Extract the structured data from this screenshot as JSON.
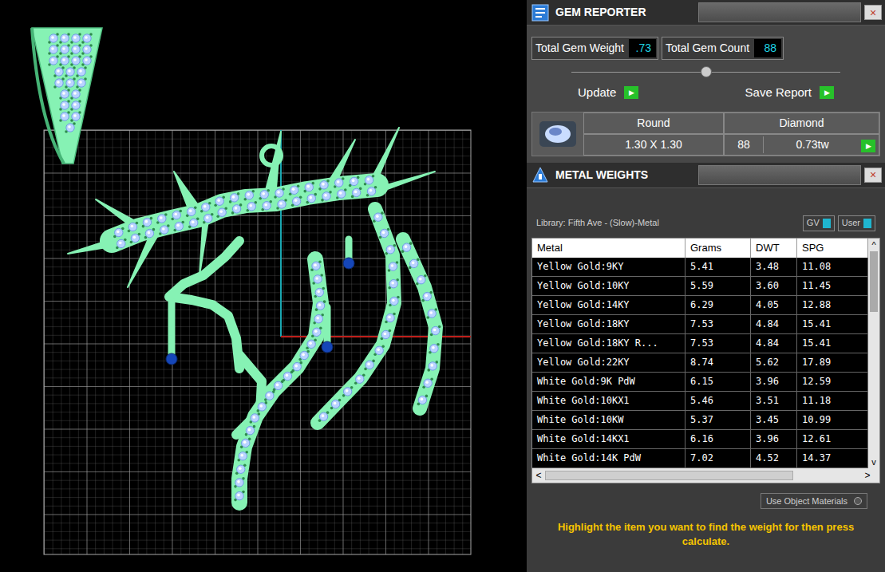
{
  "gem_reporter": {
    "title": "GEM REPORTER",
    "close": "×",
    "total_gem_weight": {
      "label": "Total Gem Weight",
      "value": ".73"
    },
    "total_gem_count": {
      "label": "Total Gem Count",
      "value": "88"
    },
    "slider": {
      "level": 0.5
    },
    "buttons": [
      {
        "label": "Update",
        "arrow": "▶"
      },
      {
        "label": "Save Report",
        "arrow": "▶"
      }
    ],
    "gems": [
      {
        "shape": "Round",
        "material": "Diamond",
        "size": "1.30 X 1.30",
        "count": "88",
        "weight": "0.73tw",
        "arrow": "▶"
      }
    ]
  },
  "metal_weights": {
    "title": "METAL WEIGHTS",
    "close": "×",
    "library": "Library: Fifth Ave - (Slow)-Metal",
    "toggles": [
      {
        "label": "GV",
        "on": true
      },
      {
        "label": "User",
        "on": true
      }
    ],
    "columns": [
      "Metal",
      "Grams",
      "DWT",
      "SPG"
    ],
    "rows": [
      [
        "Yellow Gold:9KY",
        "5.41",
        "3.48",
        "11.08"
      ],
      [
        "Yellow Gold:10KY",
        "5.59",
        "3.60",
        "11.45"
      ],
      [
        "Yellow Gold:14KY",
        "6.29",
        "4.05",
        "12.88"
      ],
      [
        "Yellow Gold:18KY",
        "7.53",
        "4.84",
        "15.41"
      ],
      [
        "Yellow Gold:18KY R...",
        "7.53",
        "4.84",
        "15.41"
      ],
      [
        "Yellow Gold:22KY",
        "8.74",
        "5.62",
        "17.89"
      ],
      [
        "White Gold:9K PdW",
        "6.15",
        "3.96",
        "12.59"
      ],
      [
        "White Gold:10KX1",
        "5.46",
        "3.51",
        "11.18"
      ],
      [
        "White Gold:10KW",
        "5.37",
        "3.45",
        "10.99"
      ],
      [
        "White Gold:14KX1",
        "6.16",
        "3.96",
        "12.61"
      ],
      [
        "White Gold:14K PdW",
        "7.02",
        "4.52",
        "14.37"
      ]
    ],
    "vertical_scroll": {
      "up": "^",
      "down": "v",
      "level": 0.3
    },
    "horizontal_scroll": {
      "left": "<",
      "right": ">",
      "level": 0.8
    },
    "use_object_materials": {
      "label": "Use Object Materials",
      "on": false
    },
    "hint": "Highlight the item you want to find the weight for then press calculate."
  }
}
